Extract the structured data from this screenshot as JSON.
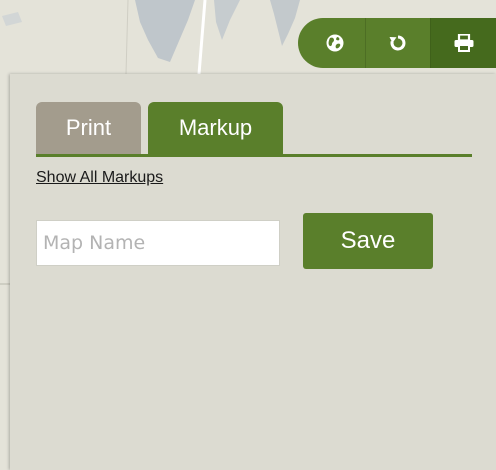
{
  "toolbar": {
    "buttons": [
      {
        "icon": "globe-icon"
      },
      {
        "icon": "refresh-icon"
      },
      {
        "icon": "printer-icon"
      }
    ],
    "accent_color": "#5a7f2b"
  },
  "panel": {
    "tabs": [
      {
        "label": "Print",
        "active": false
      },
      {
        "label": "Markup",
        "active": true
      }
    ],
    "show_all_link": "Show All Markups",
    "map_name_input": {
      "value": "",
      "placeholder": "Map Name"
    },
    "save_label": "Save"
  }
}
